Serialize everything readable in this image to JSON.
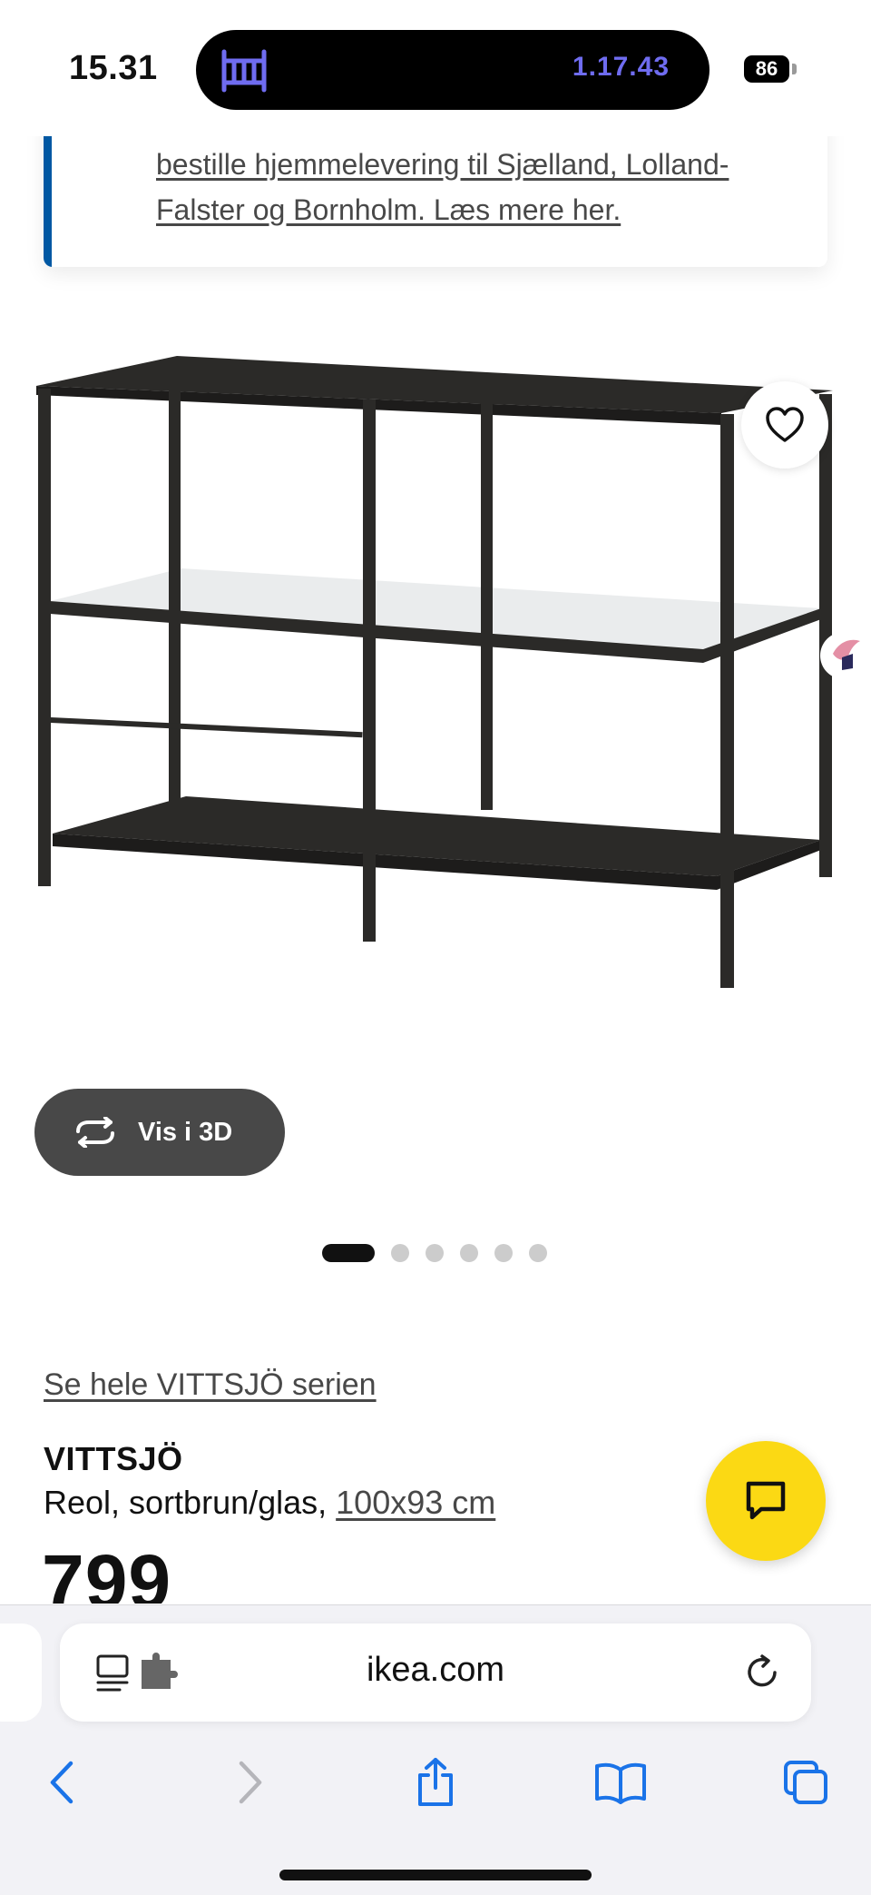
{
  "status_bar": {
    "time": "15.31",
    "activity_icon": "crib-icon",
    "timer": "1.17.43",
    "battery": "86"
  },
  "notice": {
    "text": "bestille hjemmelevering til Sjælland, Lolland-Falster og Bornholm. Læs mere her.",
    "accent_color": "#0058a3"
  },
  "product": {
    "image_alt": "VITTSJÖ shelving unit",
    "view_3d_label": "Vis i 3D",
    "carousel": {
      "count": 6,
      "active_index": 0
    },
    "series_link": "Se hele VITTSJÖ serien",
    "name": "VITTSJÖ",
    "description_prefix": "Reol, sortbrun/glas, ",
    "size_link": "100x93 cm",
    "price": "799"
  },
  "chat_button": {
    "icon": "chat-icon",
    "color": "#fbd914"
  },
  "safari": {
    "url": "ikea.com",
    "icons": {
      "left": [
        "reader-icon",
        "extension-icon"
      ],
      "right": "reload-icon",
      "toolbar": [
        "back-icon",
        "forward-icon",
        "share-icon",
        "bookmarks-icon",
        "tabs-icon"
      ]
    },
    "accent_color": "#1a73e8"
  }
}
